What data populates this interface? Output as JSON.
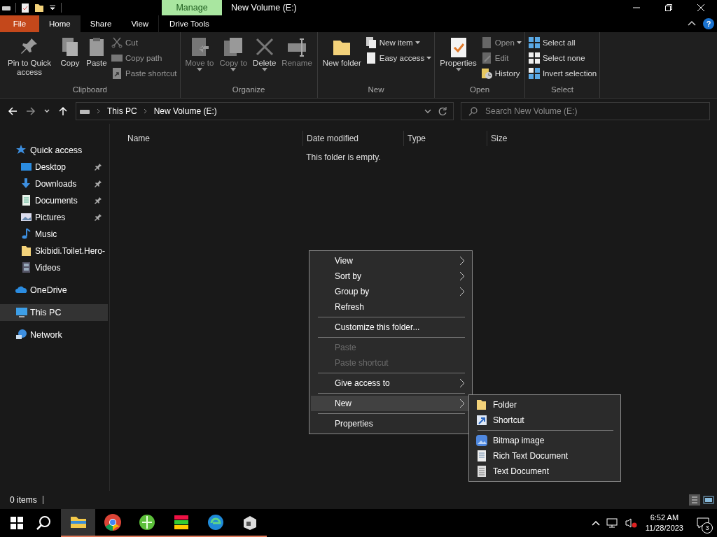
{
  "window": {
    "title": "New Volume (E:)",
    "context_tab": "Manage",
    "help": "?"
  },
  "ribbon_tabs": [
    {
      "label": "File",
      "kind": "file",
      "selected": false
    },
    {
      "label": "Home",
      "kind": "tab",
      "selected": true
    },
    {
      "label": "Share",
      "kind": "tab",
      "selected": false
    },
    {
      "label": "View",
      "kind": "tab",
      "selected": false
    },
    {
      "label": "Drive Tools",
      "kind": "tab",
      "selected": false
    }
  ],
  "ribbon_groups": [
    {
      "label": "Clipboard",
      "large": [
        {
          "label": "Pin to Quick access",
          "disabled": false,
          "dropdown": false
        },
        {
          "label": "Copy",
          "disabled": false,
          "dropdown": false
        },
        {
          "label": "Paste",
          "disabled": false,
          "dropdown": false
        }
      ],
      "small": [
        {
          "label": "Cut",
          "disabled": true,
          "dropdown": false
        },
        {
          "label": "Copy path",
          "disabled": true,
          "dropdown": false
        },
        {
          "label": "Paste shortcut",
          "disabled": true,
          "dropdown": false
        }
      ]
    },
    {
      "label": "Organize",
      "large": [
        {
          "label": "Move to",
          "disabled": true,
          "dropdown": true
        },
        {
          "label": "Copy to",
          "disabled": true,
          "dropdown": true
        },
        {
          "label": "Delete",
          "disabled": false,
          "dropdown": true
        },
        {
          "label": "Rename",
          "disabled": true,
          "dropdown": false
        }
      ]
    },
    {
      "label": "New",
      "large": [
        {
          "label": "New folder",
          "disabled": false,
          "dropdown": false
        }
      ],
      "small": [
        {
          "label": "New item",
          "disabled": false,
          "dropdown": true
        },
        {
          "label": "Easy access",
          "disabled": false,
          "dropdown": true
        }
      ]
    },
    {
      "label": "Open",
      "large": [
        {
          "label": "Properties",
          "disabled": false,
          "dropdown": true
        }
      ],
      "small": [
        {
          "label": "Open",
          "disabled": true,
          "dropdown": true
        },
        {
          "label": "Edit",
          "disabled": true,
          "dropdown": false
        },
        {
          "label": "History",
          "disabled": false,
          "dropdown": false
        }
      ]
    },
    {
      "label": "Select",
      "small": [
        {
          "label": "Select all",
          "disabled": false,
          "dropdown": false
        },
        {
          "label": "Select none",
          "disabled": false,
          "dropdown": false
        },
        {
          "label": "Invert selection",
          "disabled": false,
          "dropdown": false
        }
      ]
    }
  ],
  "address": {
    "crumbs": [
      "This PC",
      "New Volume (E:)"
    ],
    "search_placeholder": "Search New Volume (E:)"
  },
  "sidebar": {
    "items": [
      {
        "label": "Quick access",
        "selected": false,
        "children": [
          {
            "label": "Desktop",
            "pinned": true,
            "selected": false
          },
          {
            "label": "Downloads",
            "pinned": true,
            "selected": false
          },
          {
            "label": "Documents",
            "pinned": true,
            "selected": false
          },
          {
            "label": "Pictures",
            "pinned": true,
            "selected": false
          },
          {
            "label": "Music",
            "pinned": false,
            "selected": false
          },
          {
            "label": "Skibidi.Toilet.Hero-",
            "pinned": false,
            "selected": false
          },
          {
            "label": "Videos",
            "pinned": false,
            "selected": false
          }
        ]
      },
      {
        "label": "OneDrive",
        "selected": false
      },
      {
        "label": "This PC",
        "selected": true
      },
      {
        "label": "Network",
        "selected": false
      }
    ]
  },
  "table": {
    "columns": [
      "Name",
      "Date modified",
      "Type",
      "Size"
    ],
    "empty_message": "This folder is empty."
  },
  "context_menu": {
    "items": [
      {
        "label": "View",
        "kind": "submenu",
        "disabled": false,
        "selected": false
      },
      {
        "label": "Sort by",
        "kind": "submenu",
        "disabled": false,
        "selected": false
      },
      {
        "label": "Group by",
        "kind": "submenu",
        "disabled": false,
        "selected": false
      },
      {
        "label": "Refresh",
        "kind": "item",
        "disabled": false,
        "selected": false
      },
      {
        "kind": "separator"
      },
      {
        "label": "Customize this folder...",
        "kind": "item",
        "disabled": false,
        "selected": false
      },
      {
        "kind": "separator"
      },
      {
        "label": "Paste",
        "kind": "item",
        "disabled": true,
        "selected": false
      },
      {
        "label": "Paste shortcut",
        "kind": "item",
        "disabled": true,
        "selected": false
      },
      {
        "kind": "separator"
      },
      {
        "label": "Give access to",
        "kind": "submenu",
        "disabled": false,
        "selected": false
      },
      {
        "kind": "separator"
      },
      {
        "label": "New",
        "kind": "submenu",
        "disabled": false,
        "selected": true
      },
      {
        "kind": "separator"
      },
      {
        "label": "Properties",
        "kind": "item",
        "disabled": false,
        "selected": false
      }
    ]
  },
  "submenu": {
    "items": [
      {
        "label": "Folder",
        "kind": "item"
      },
      {
        "label": "Shortcut",
        "kind": "item"
      },
      {
        "kind": "separator"
      },
      {
        "label": "Bitmap image",
        "kind": "item"
      },
      {
        "label": "Rich Text Document",
        "kind": "item"
      },
      {
        "label": "Text Document",
        "kind": "item"
      }
    ]
  },
  "status_bar": {
    "count": "0 items"
  },
  "taskbar": {
    "apps": [
      {
        "active": true
      },
      {
        "active": false
      },
      {
        "active": false
      },
      {
        "active": false
      },
      {
        "active": false
      },
      {
        "active": false
      }
    ],
    "time": "6:52 AM",
    "date": "11/28/2023",
    "notifications": "3"
  }
}
